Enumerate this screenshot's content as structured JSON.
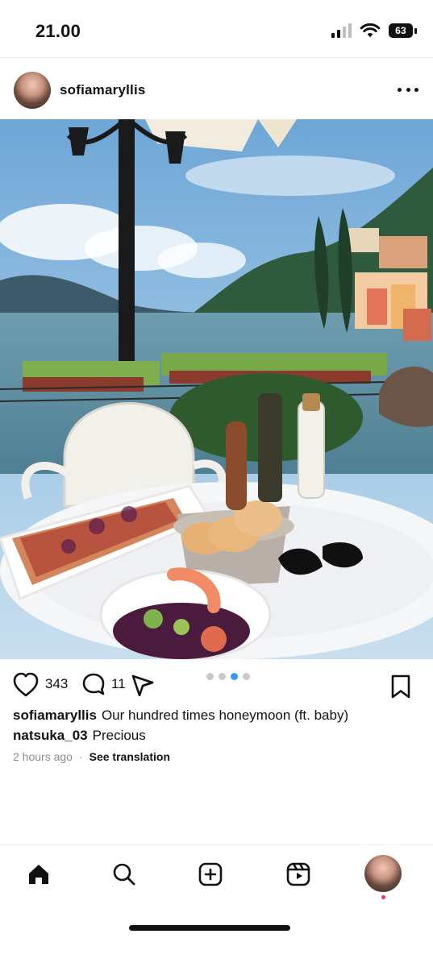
{
  "status_bar": {
    "time": "21.00",
    "battery": "63"
  },
  "post": {
    "username": "sofiamaryllis",
    "more_icon": "more-horizontal-icon",
    "likes": "343",
    "comments": "11",
    "carousel": {
      "total": 4,
      "active_index": 2
    },
    "caption": {
      "username": "sofiamaryllis",
      "text": "Our hundred times honeymoon (ft. baby)"
    },
    "top_comment": {
      "username": "natsuka_03",
      "text": "Precious"
    },
    "time_ago": "2 hours ago",
    "see_translation": "See translation"
  },
  "nav": {
    "items": [
      "home-icon",
      "search-icon",
      "create-icon",
      "reels-icon",
      "profile-avatar"
    ]
  },
  "colors": {
    "accent": "#3897f0",
    "text": "#111111",
    "muted": "#8e8e8e",
    "notification": "#ff2d55"
  }
}
